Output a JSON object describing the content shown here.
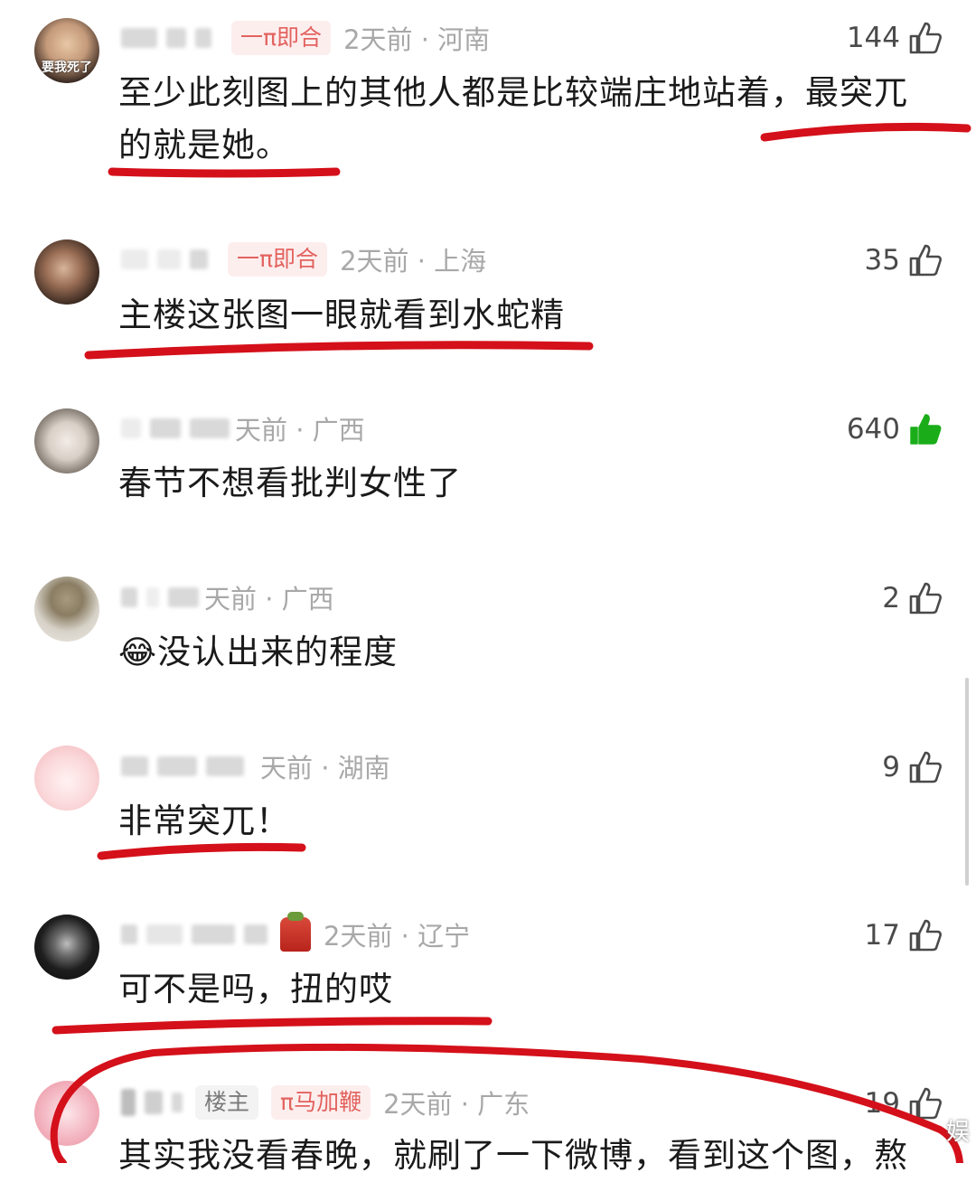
{
  "comments": [
    {
      "tag": "一π即合",
      "time_loc": "2天前 · 河南",
      "likes": "144",
      "liked": false,
      "text": "至少此刻图上的其他人都是比较端庄地站着，最突兀的就是她。"
    },
    {
      "tag": "一π即合",
      "time_loc": "2天前 · 上海",
      "likes": "35",
      "liked": false,
      "text": "主楼这张图一眼就看到水蛇精"
    },
    {
      "time_loc": "天前 · 广西",
      "likes": "640",
      "liked": true,
      "text": "春节不想看批判女性了"
    },
    {
      "time_loc": "天前 · 广西",
      "likes": "2",
      "liked": false,
      "emoji": "😂",
      "text": "没认出来的程度"
    },
    {
      "time_loc": "天前 · 湖南",
      "likes": "9",
      "liked": false,
      "text": "非常突兀！"
    },
    {
      "time_loc": "2天前 · 辽宁",
      "likes": "17",
      "liked": false,
      "text": "可不是吗，扭的哎"
    },
    {
      "tag_owner": "楼主",
      "tag": "π马加鞭",
      "time_loc": "2天前 · 广东",
      "likes": "19",
      "liked": false,
      "text": "其实我没看春晚，就刷了一下微博，看到这个图，熬"
    }
  ],
  "avatar_text": "要我死了",
  "watermark": "娱",
  "colors": {
    "underline": "#d4101a",
    "liked": "#1aad19",
    "tag_pink": "#e2635f"
  }
}
